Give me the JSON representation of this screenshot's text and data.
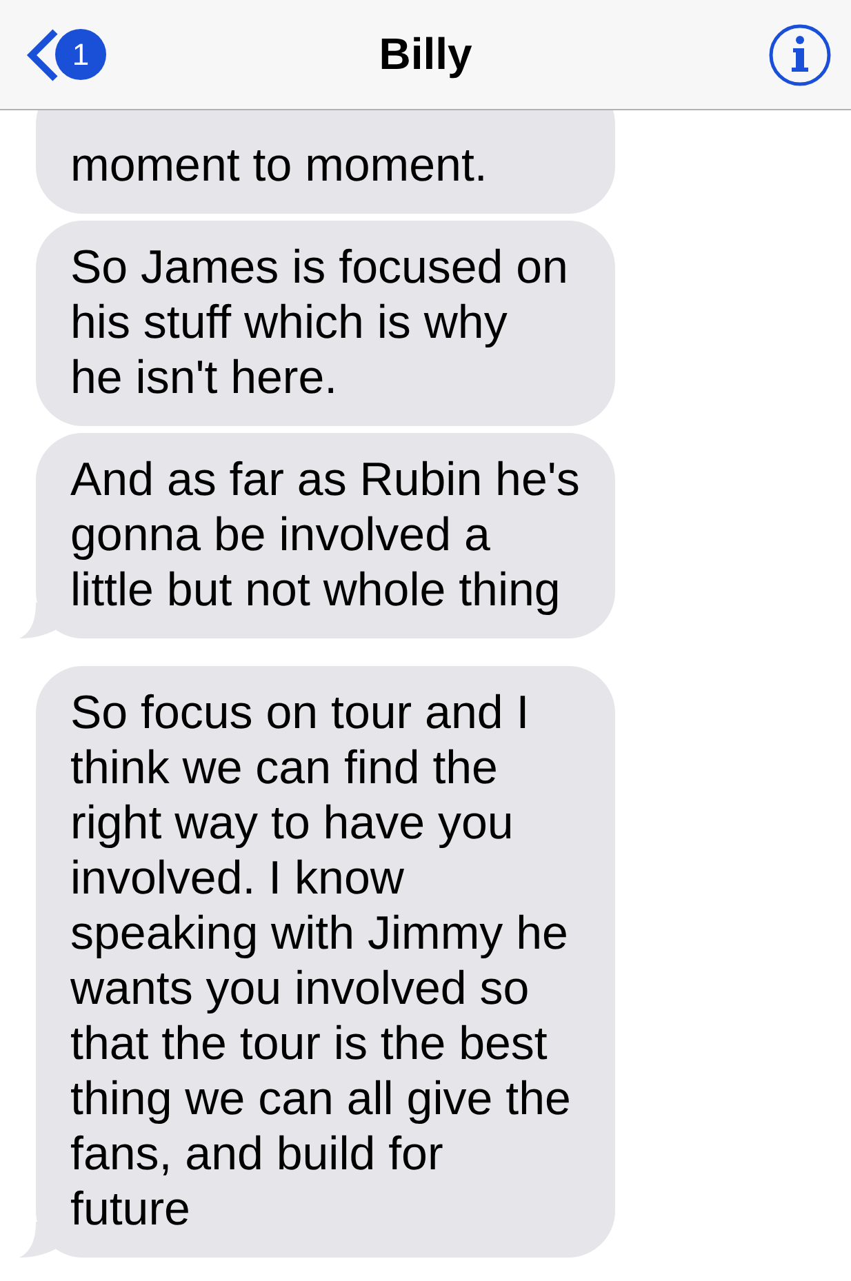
{
  "header": {
    "back_badge": "1",
    "title": "Billy"
  },
  "messages": [
    {
      "lines": [
        "moment to moment."
      ],
      "tail": false,
      "clipped": true
    },
    {
      "lines": [
        "So James is focused on",
        "his stuff which is why",
        "he isn't here."
      ],
      "tail": false,
      "clipped": false
    },
    {
      "lines": [
        "And as far as Rubin he's",
        "gonna be involved a",
        "little but not whole thing"
      ],
      "tail": true,
      "clipped": false
    },
    {
      "lines": [
        "So focus on tour and I",
        "think we can find the",
        "right way to have you",
        "involved. I know",
        "speaking with Jimmy he",
        "wants you involved so",
        "that the tour is the best",
        "thing we can all give the",
        "fans, and build for",
        "future"
      ],
      "tail": true,
      "clipped": false
    }
  ]
}
